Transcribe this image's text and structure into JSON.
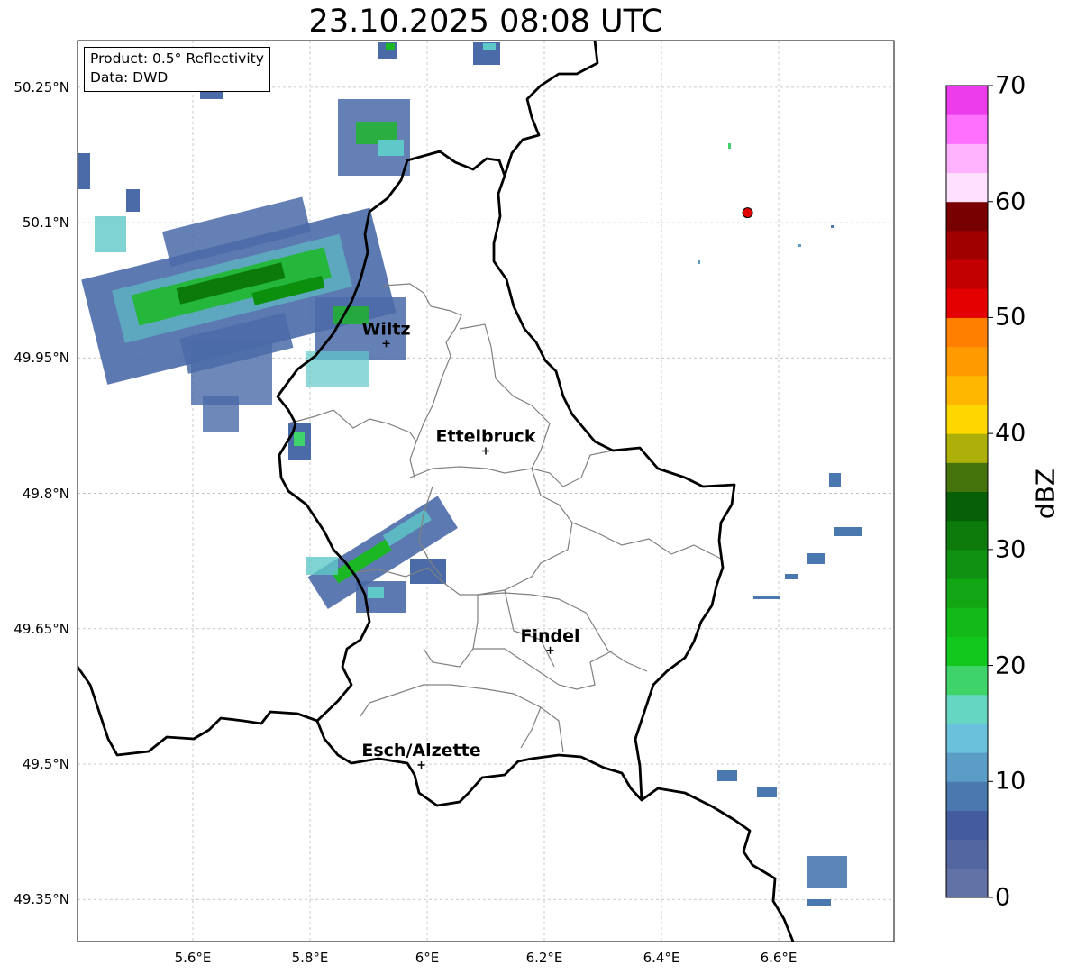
{
  "title": "23.10.2025 08:08 UTC",
  "info_box": {
    "product": "Product: 0.5° Reflectivity",
    "data": "Data: DWD"
  },
  "lat_ticks": [
    "50.25°N",
    "50.1°N",
    "49.95°N",
    "49.8°N",
    "49.65°N",
    "49.5°N",
    "49.35°N"
  ],
  "lon_ticks": [
    "5.6°E",
    "5.8°E",
    "6°E",
    "6.2°E",
    "6.4°E",
    "6.6°E"
  ],
  "cities": [
    {
      "name": "Wiltz",
      "lon": 5.93,
      "lat": 49.966
    },
    {
      "name": "Ettelbruck",
      "lon": 6.1,
      "lat": 49.847
    },
    {
      "name": "Findel",
      "lon": 6.21,
      "lat": 49.626
    },
    {
      "name": "Esch/Alzette",
      "lon": 5.99,
      "lat": 49.499
    }
  ],
  "marker": {
    "lon": 6.547,
    "lat": 50.111,
    "color": "#e00000"
  },
  "colorbar": {
    "label": "dBZ",
    "ticks": [
      "0",
      "10",
      "20",
      "30",
      "40",
      "50",
      "60",
      "70"
    ],
    "range": [
      0,
      70
    ],
    "step": 2.5,
    "colors": [
      "#6271a6",
      "#53669f",
      "#435c9e",
      "#4a79b0",
      "#5b9dc6",
      "#69c1dc",
      "#64d6c2",
      "#3fd46a",
      "#12c81d",
      "#12b919",
      "#12a615",
      "#109111",
      "#0c7b0c",
      "#075f07",
      "#44740b",
      "#adb009",
      "#ffd700",
      "#ffb700",
      "#ff9b00",
      "#ff7f00",
      "#e50000",
      "#c30000",
      "#a00000",
      "#780000",
      "#ffe0ff",
      "#ffb3ff",
      "#ff70ff",
      "#ec3cec"
    ]
  }
}
